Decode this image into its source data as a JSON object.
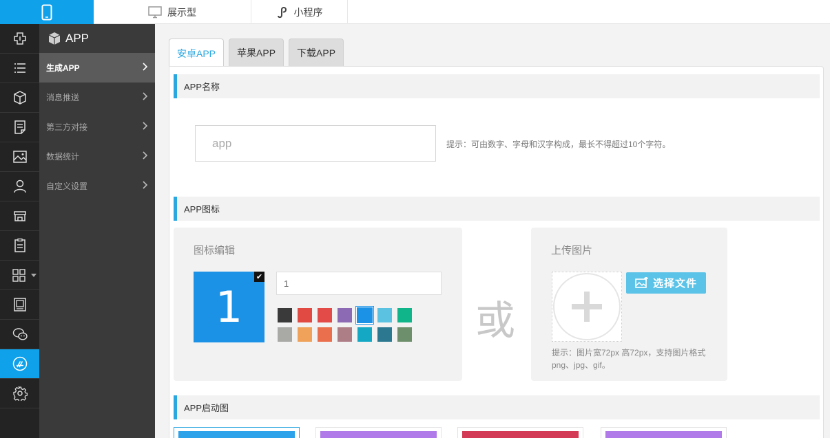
{
  "topbar": {
    "tabs": [
      {
        "label": "展示型",
        "icon": "monitor-icon"
      },
      {
        "label": "小程序",
        "icon": "miniprogram-icon"
      }
    ],
    "active_icon": "phone-icon"
  },
  "iconbar": {
    "items": [
      {
        "icon": "plugin-icon"
      },
      {
        "icon": "list-icon"
      },
      {
        "icon": "cube-icon"
      },
      {
        "icon": "document-icon"
      },
      {
        "icon": "image-icon"
      },
      {
        "icon": "user-icon"
      },
      {
        "icon": "store-icon"
      },
      {
        "icon": "clipboard-icon"
      },
      {
        "icon": "grid-icon"
      },
      {
        "icon": "photo-frame-icon"
      },
      {
        "icon": "wechat-icon"
      },
      {
        "icon": "app-store-icon",
        "active": true
      },
      {
        "icon": "gear-icon"
      }
    ]
  },
  "submenu": {
    "title": "APP",
    "items": [
      {
        "label": "生成APP",
        "active": true
      },
      {
        "label": "消息推送"
      },
      {
        "label": "第三方对接"
      },
      {
        "label": "数据统计"
      },
      {
        "label": "自定义设置"
      }
    ]
  },
  "tabs": [
    {
      "label": "安卓APP",
      "active": true
    },
    {
      "label": "苹果APP"
    },
    {
      "label": "下载APP"
    }
  ],
  "sections": {
    "name_title": "APP名称",
    "icon_title": "APP图标",
    "launch_title": "APP启动图"
  },
  "app_name": {
    "placeholder": "app",
    "value": "",
    "hint": "提示：可由数字、字母和汉字构成，最长不得超过10个字符。"
  },
  "icon_edit": {
    "title": "图标编辑",
    "preview_text": "1",
    "input_value": "1",
    "check_glyph": "✔",
    "colors": [
      "#3a3a3a",
      "#e04a43",
      "#e24b48",
      "#8d6bb4",
      "#1c92e6",
      "#5bc3e1",
      "#11b58a",
      "#a9a9a6",
      "#f0a25a",
      "#ea6f4c",
      "#ae7e86",
      "#14a8c4",
      "#2b7890",
      "#6e8f6c"
    ],
    "selected_color": "#1c92e6"
  },
  "or_text": "或",
  "upload": {
    "title": "上传图片",
    "button_label": "选择文件",
    "hint": "提示：图片宽72px 高72px，支持图片格式png、jpg、gif。"
  },
  "launch_images": [
    {
      "color": "#2ba2ea",
      "selected": true
    },
    {
      "color": "#b07ae8"
    },
    {
      "color": "#d23a55"
    },
    {
      "color": "#b07ae8"
    }
  ],
  "colors": {
    "accent": "#0fa1ea",
    "sidebar_dark": "#232323",
    "submenu": "#3a3a3a"
  }
}
